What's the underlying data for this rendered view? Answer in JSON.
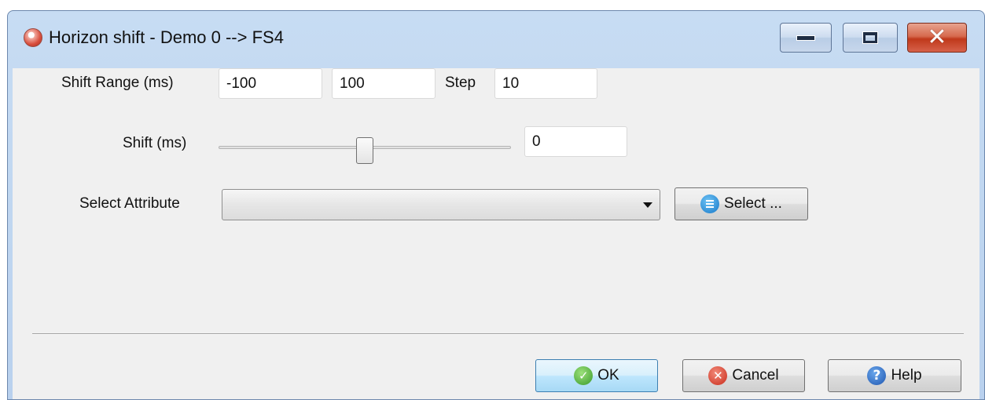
{
  "window": {
    "title": "Horizon shift - Demo 0 --> FS4",
    "app_icon": "seismic-app-icon",
    "controls": {
      "minimize_icon": "minimize-icon",
      "maximize_icon": "maximize-icon",
      "close_icon": "close-icon"
    }
  },
  "shift_range": {
    "label": "Shift Range (ms)",
    "min_value": "-100",
    "max_value": "100",
    "step_label": "Step",
    "step_value": "10"
  },
  "shift": {
    "label": "Shift (ms)",
    "slider_value": 0,
    "slider_min": -100,
    "slider_max": 100,
    "value_text": "0"
  },
  "attribute": {
    "label": "Select Attribute",
    "selected": "",
    "select_button": "Select ...",
    "select_button_icon": "list-icon"
  },
  "buttons": {
    "ok": "OK",
    "ok_icon": "checkmark-icon",
    "cancel": "Cancel",
    "cancel_icon": "cancel-icon",
    "help": "Help",
    "help_icon": "help-icon"
  }
}
